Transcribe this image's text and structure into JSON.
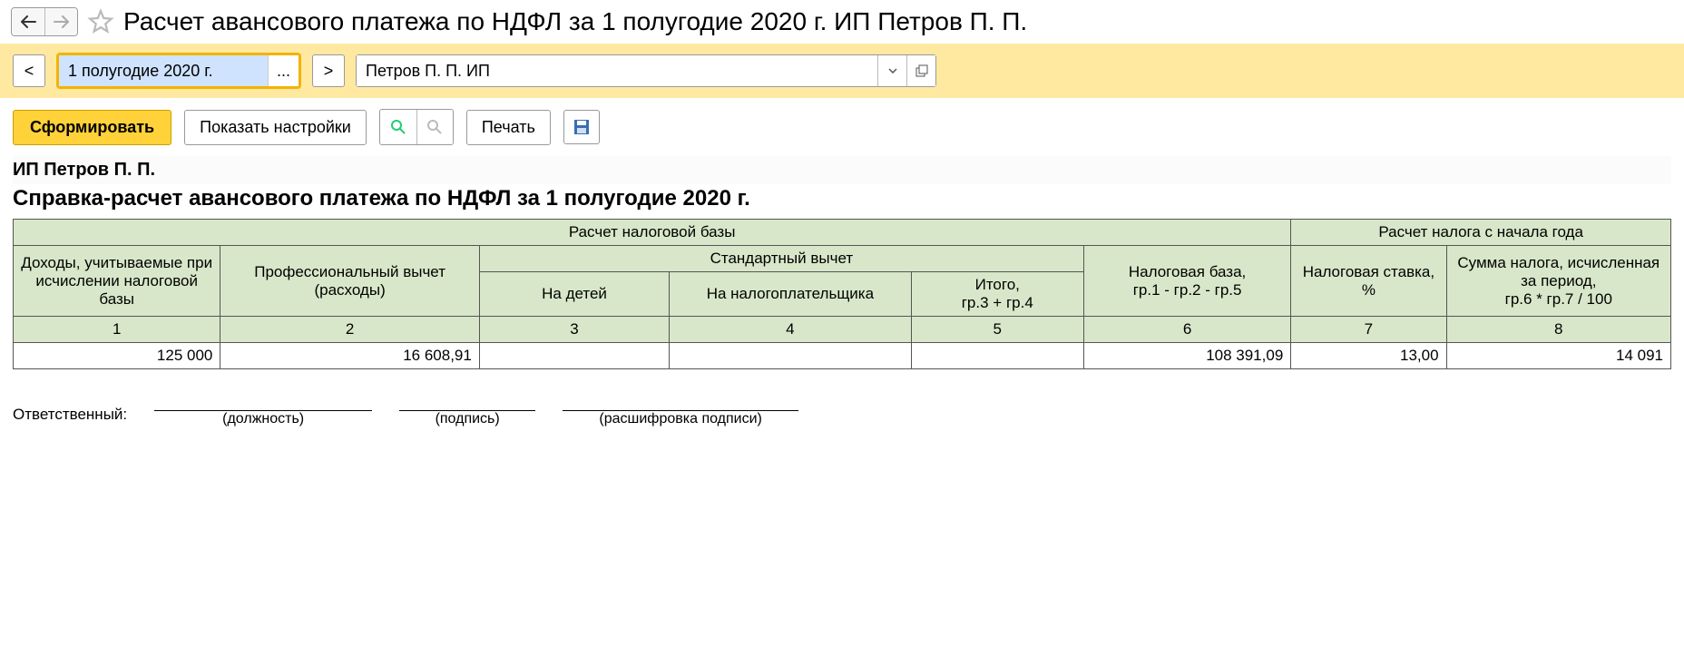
{
  "title": "Расчет авансового платежа по НДФЛ за 1 полугодие 2020 г. ИП Петров П. П.",
  "filter": {
    "prev": "<",
    "next": ">",
    "period_value": "1 полугодие 2020 г.",
    "ellipsis": "...",
    "org_value": "Петров П. П. ИП"
  },
  "toolbar": {
    "generate": "Сформировать",
    "show_settings": "Показать настройки",
    "print": "Печать"
  },
  "report": {
    "org": "ИП Петров П. П.",
    "heading": "Справка-расчет авансового платежа по НДФЛ за 1 полугодие 2020 г.",
    "group_base": "Расчет налоговой базы",
    "group_tax": "Расчет налога с начала года",
    "col1": "Доходы, учитываемые при исчислении налоговой базы",
    "col2": "Профессиональный вычет (расходы)",
    "std_group": "Стандартный вычет",
    "col3": "На детей",
    "col4": "На налогоплательщика",
    "col5": "Итого,\nгр.3 + гр.4",
    "col6": "Налоговая база,\nгр.1 - гр.2 - гр.5",
    "col7": "Налоговая ставка, %",
    "col8": "Сумма налога, исчисленная за период,\nгр.6 * гр.7 / 100",
    "num1": "1",
    "num2": "2",
    "num3": "3",
    "num4": "4",
    "num5": "5",
    "num6": "6",
    "num7": "7",
    "num8": "8",
    "v1": "125 000",
    "v2": "16 608,91",
    "v3": "",
    "v4": "",
    "v5": "",
    "v6": "108 391,09",
    "v7": "13,00",
    "v8": "14 091"
  },
  "sign": {
    "label": "Ответственный:",
    "post": "(должность)",
    "signature": "(подпись)",
    "decipher": "(расшифровка подписи)"
  }
}
